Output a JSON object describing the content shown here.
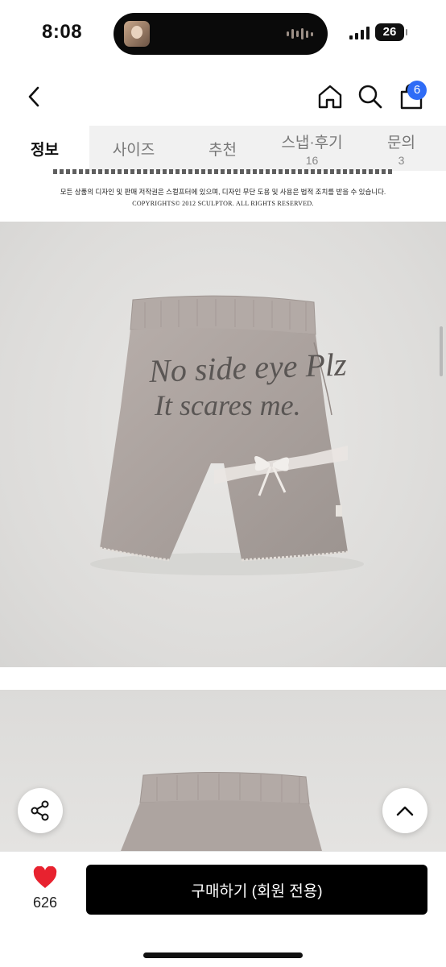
{
  "status_bar": {
    "time": "8:08",
    "battery": "26"
  },
  "nav": {
    "back_icon": "chevron-left-icon",
    "home_icon": "home-icon",
    "search_icon": "search-icon",
    "cart_icon": "shopping-bag-icon",
    "cart_count": "6"
  },
  "tabs": [
    {
      "label": "정보",
      "active": true
    },
    {
      "label": "사이즈"
    },
    {
      "label": "추천"
    },
    {
      "label": "스냅·후기",
      "count": "16"
    },
    {
      "label": "문의",
      "count": "3"
    }
  ],
  "notice": {
    "line1": "모든 상품의 디자인 및 판매 저작권은 스컬프터에 있으며, 디자인 무단 도용 및 사용은 법적 조치를 받을 수 있습니다.",
    "line2": "COPYRIGHTS© 2012 SCULPTOR. ALL RIGHTS RESERVED."
  },
  "product_image": {
    "print_line1": "No side eye Plz",
    "print_line2": "It scares me."
  },
  "floating": {
    "share_icon": "share-icon",
    "top_icon": "chevron-up-icon"
  },
  "bottom_bar": {
    "like_icon": "heart-icon",
    "like_count": "626",
    "buy_label": "구매하기 (회원 전용)"
  },
  "colors": {
    "accent_badge": "#2f6cf6",
    "heart": "#e8222f",
    "buy_button": "#000000",
    "tab_bar_bg": "#f1f1f1"
  }
}
